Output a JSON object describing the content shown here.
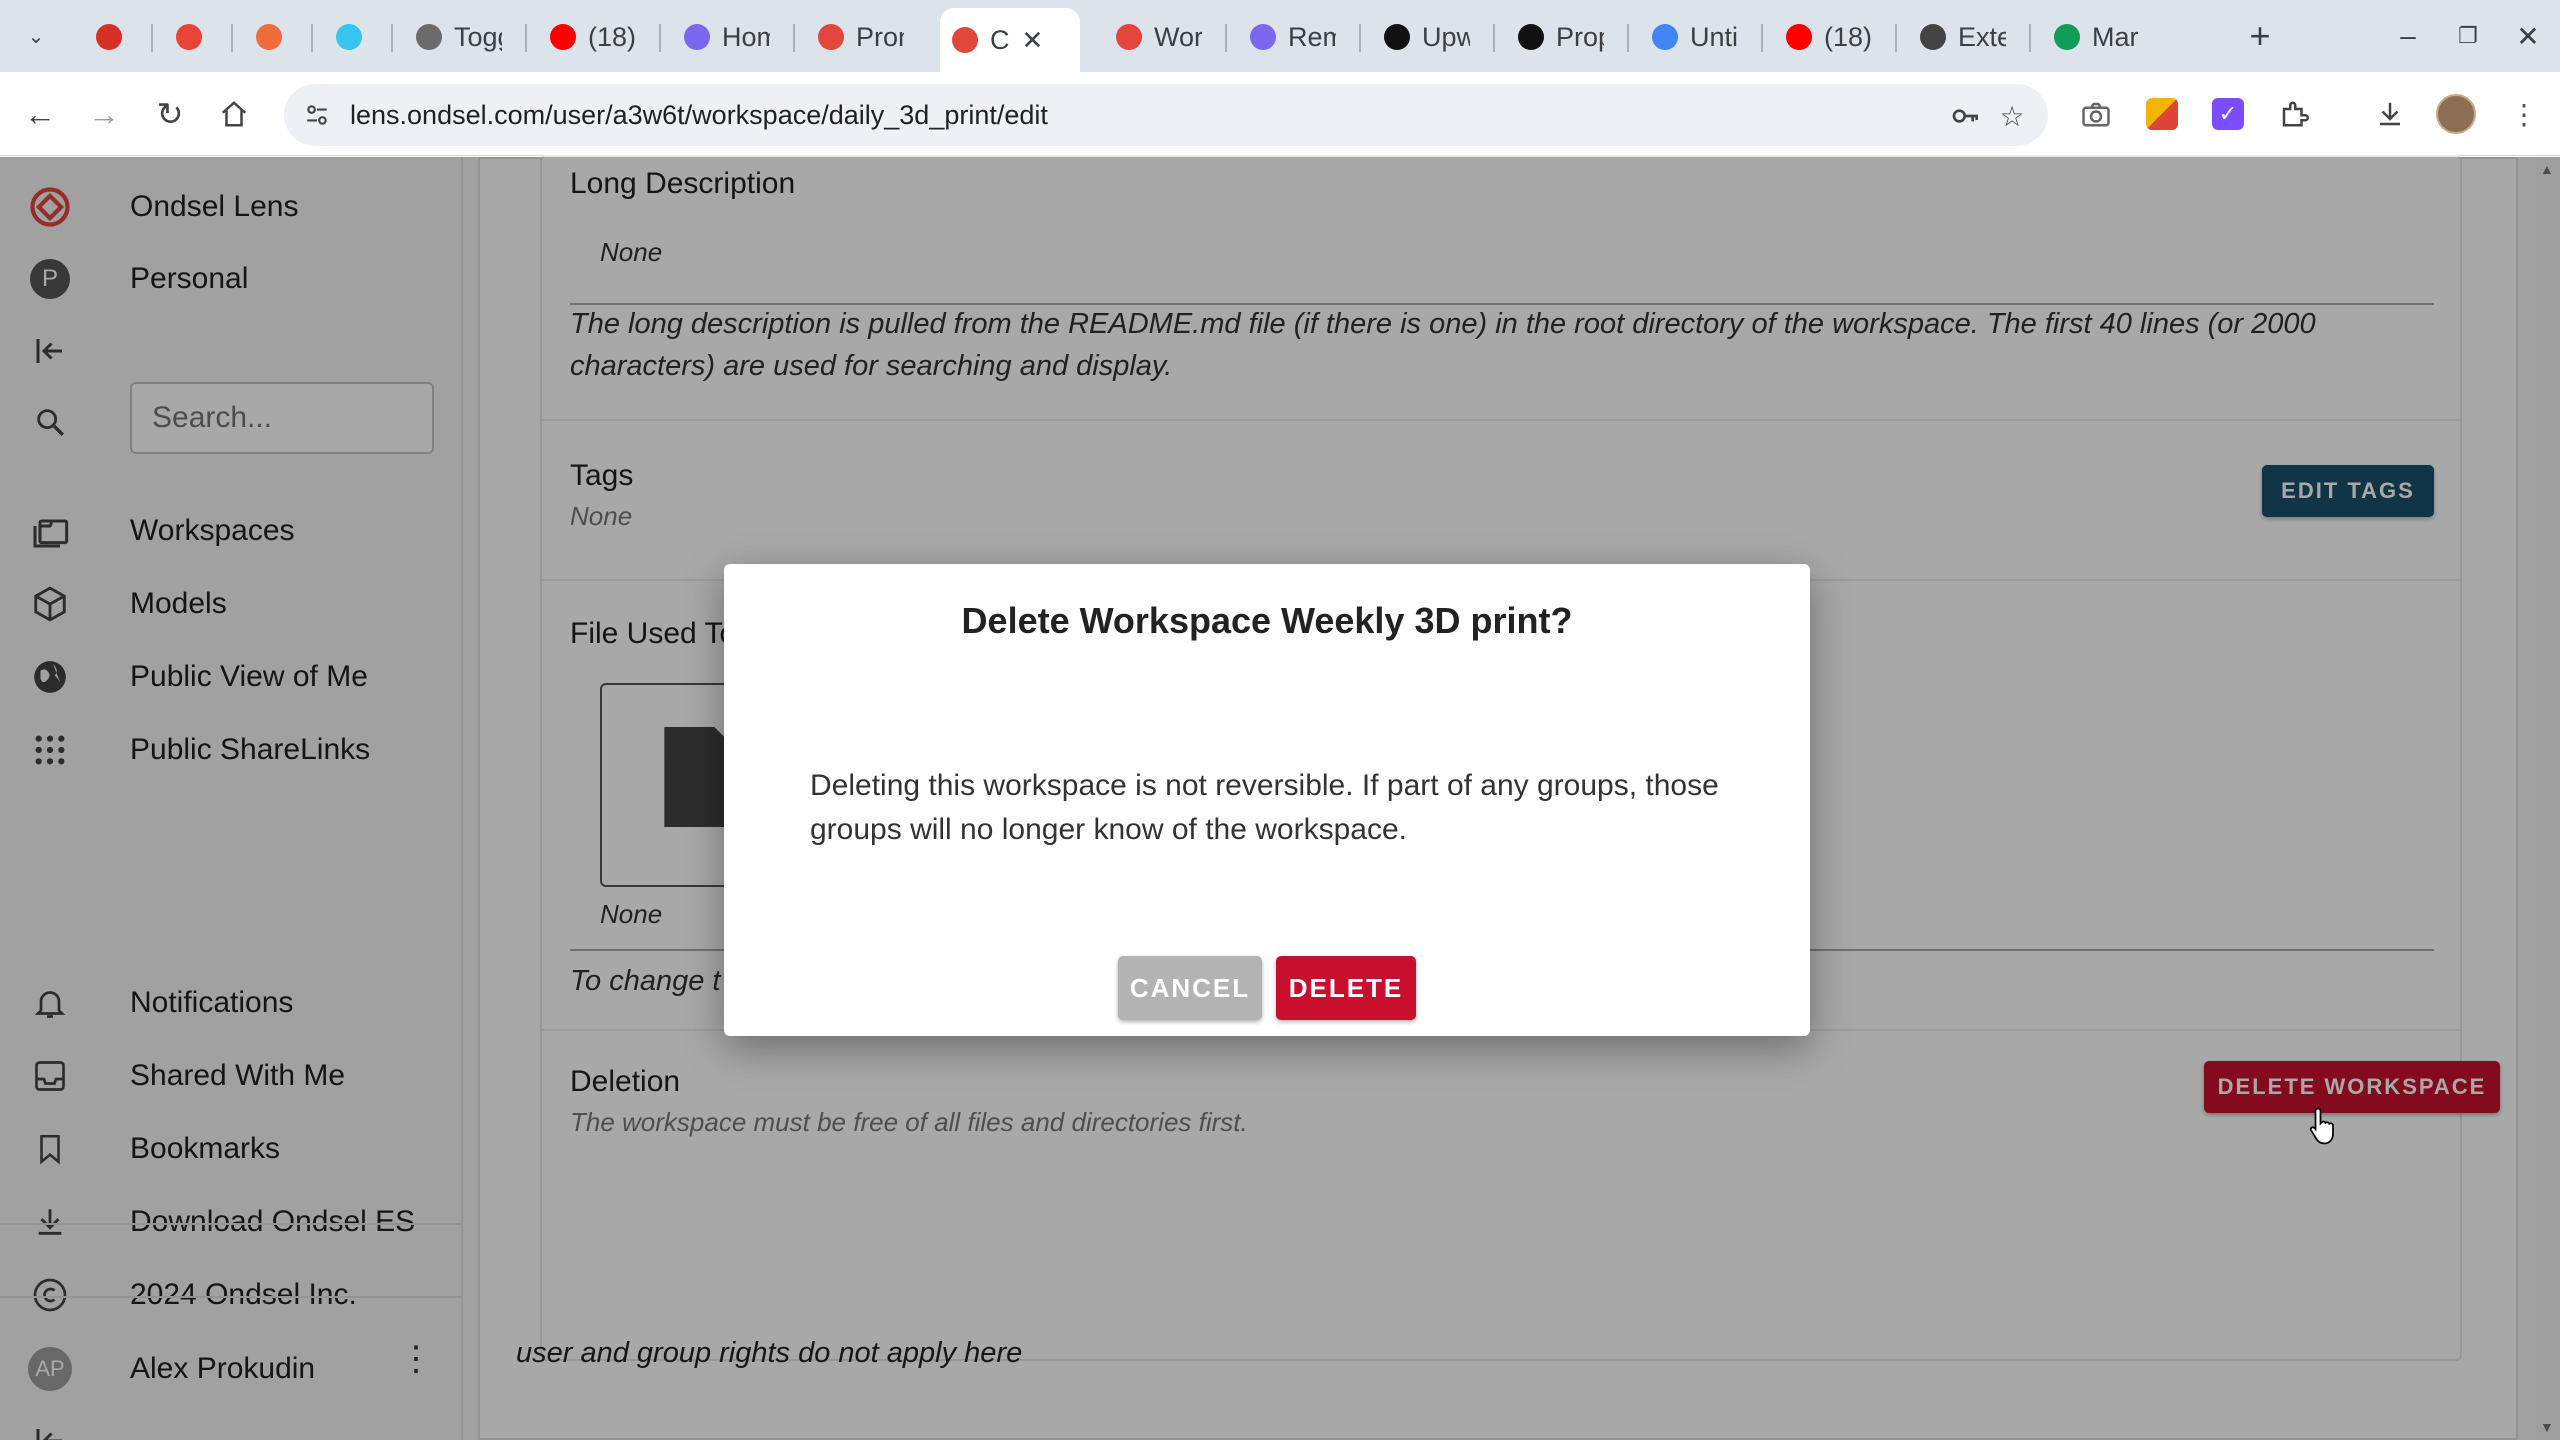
{
  "browser": {
    "tabs": [
      {
        "title": "",
        "icon": "record-icon",
        "color": "#d93025"
      },
      {
        "title": "",
        "icon": "gmail-icon",
        "color": "#ea4335"
      },
      {
        "title": "",
        "icon": "chat-icon",
        "color": "#f26b3a"
      },
      {
        "title": "",
        "icon": "slack-icon",
        "color": "#36c5f0"
      },
      {
        "title": "Togg",
        "icon": "toggl-icon",
        "color": "#6b6b6b"
      },
      {
        "title": "(18)",
        "icon": "youtube-icon",
        "color": "#ff0000"
      },
      {
        "title": "Hom",
        "icon": "clickup-icon",
        "color": "#7b68ee"
      },
      {
        "title": "Pron",
        "icon": "ondsel-icon",
        "color": "#e2463c"
      },
      {
        "title": "C",
        "icon": "ondsel-icon",
        "color": "#e2463c",
        "active": true
      },
      {
        "title": "Wor",
        "icon": "ondsel-icon",
        "color": "#e2463c"
      },
      {
        "title": "Rem",
        "icon": "clickup-icon",
        "color": "#7b68ee"
      },
      {
        "title": "Upw",
        "icon": "upwork-icon",
        "color": "#111111"
      },
      {
        "title": "Prop",
        "icon": "upwork-icon",
        "color": "#111111"
      },
      {
        "title": "Unti",
        "icon": "docs-icon",
        "color": "#4285f4"
      },
      {
        "title": "(18)",
        "icon": "youtube-icon",
        "color": "#ff0000"
      },
      {
        "title": "Exte",
        "icon": "markdown-icon",
        "color": "#444444"
      },
      {
        "title": "Marl",
        "icon": "sheets-icon",
        "color": "#0f9d58"
      }
    ],
    "url": "lens.ondsel.com/user/a3w6t/workspace/daily_3d_print/edit"
  },
  "sidebar": {
    "brand": "Ondsel Lens",
    "org_initial": "P",
    "org": "Personal",
    "search_placeholder": "Search...",
    "nav": [
      "Workspaces",
      "Models",
      "Public View of Me",
      "Public ShareLinks"
    ],
    "bottom": [
      "Notifications",
      "Shared With Me",
      "Bookmarks",
      "Download Ondsel ES",
      "2024 Ondsel Inc."
    ],
    "user_initials": "AP",
    "user_name": "Alex Prokudin"
  },
  "main": {
    "long_description": {
      "title": "Long Description",
      "value": "None",
      "help_pre": "The long description is pulled from the ",
      "help_code": "README.md",
      "help_post": " file (if there is one) in the root directory of the workspace. The first 40 lines (or 2000 characters) are used for searching and display."
    },
    "tags": {
      "title": "Tags",
      "value": "None",
      "button": "EDIT TAGS"
    },
    "file_thumbnail": {
      "title": "File Used To",
      "value": "None",
      "help": "To change t"
    },
    "deletion": {
      "title": "Deletion",
      "help": "The workspace must be free of all files and directories first.",
      "button": "DELETE WORKSPACE"
    },
    "footer_note": "user and group rights do not apply here"
  },
  "dialog": {
    "title": "Delete Workspace Weekly 3D print?",
    "body": "Deleting this workspace is not reversible. If part of any groups, those groups will no longer know of the workspace.",
    "cancel": "CANCEL",
    "delete": "DELETE"
  },
  "colors": {
    "primary": "#1c4f6c",
    "danger": "#c8102e",
    "brand": "#e2463c"
  }
}
